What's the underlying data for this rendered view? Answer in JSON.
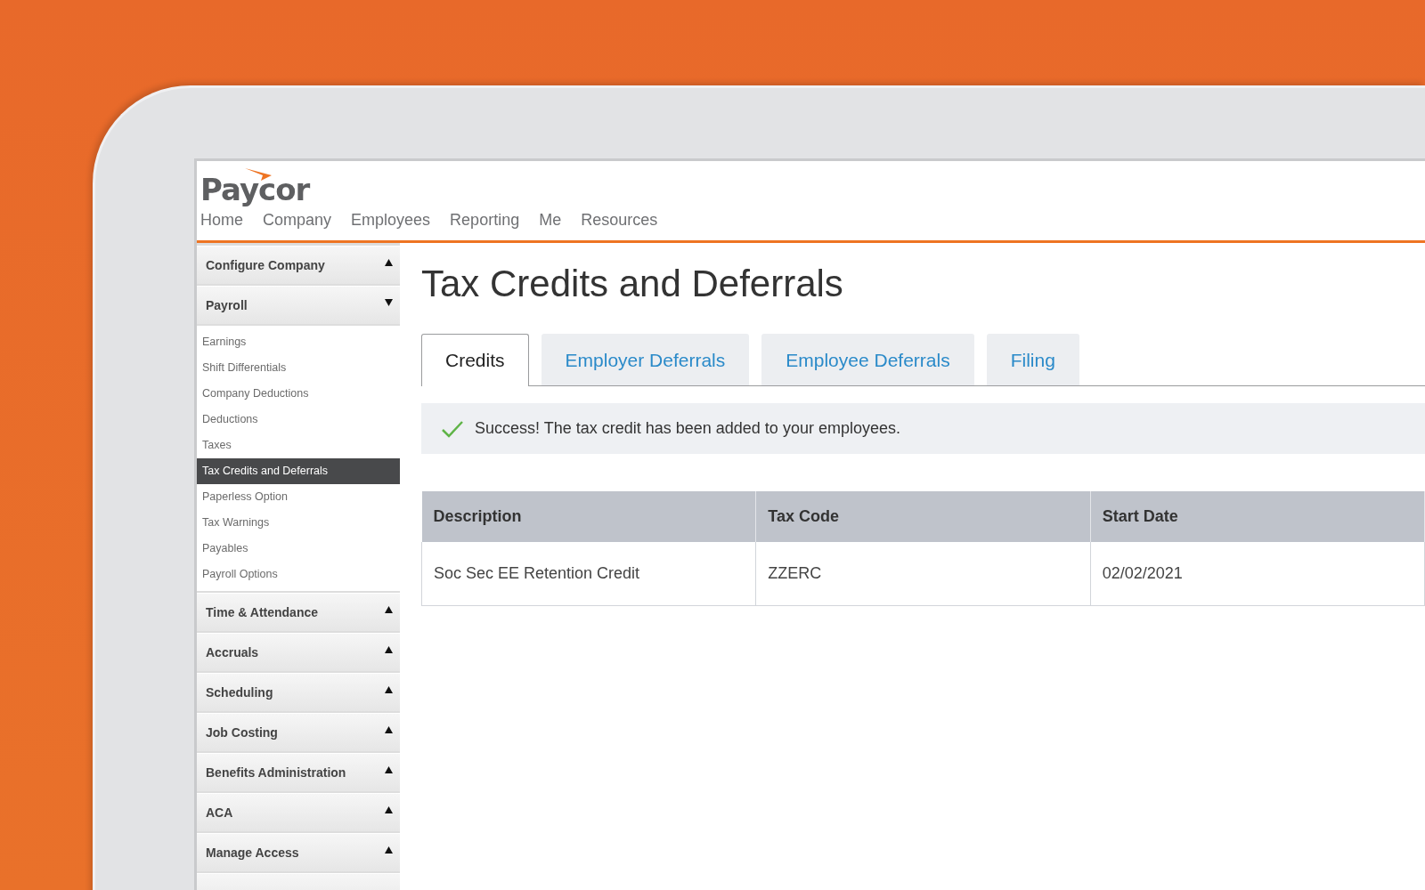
{
  "logo": {
    "text": "Paycor"
  },
  "nav": [
    "Home",
    "Company",
    "Employees",
    "Reporting",
    "Me",
    "Resources"
  ],
  "sidebar": {
    "sections": [
      {
        "label": "Configure Company",
        "expanded": false
      },
      {
        "label": "Payroll",
        "expanded": true,
        "children": [
          {
            "label": "Earnings",
            "selected": false
          },
          {
            "label": "Shift Differentials",
            "selected": false
          },
          {
            "label": "Company Deductions",
            "selected": false
          },
          {
            "label": "Deductions",
            "selected": false
          },
          {
            "label": "Taxes",
            "selected": false
          },
          {
            "label": "Tax Credits and Deferrals",
            "selected": true
          },
          {
            "label": "Paperless Option",
            "selected": false
          },
          {
            "label": "Tax Warnings",
            "selected": false
          },
          {
            "label": "Payables",
            "selected": false
          },
          {
            "label": "Payroll Options",
            "selected": false
          }
        ]
      },
      {
        "label": "Time & Attendance",
        "expanded": false
      },
      {
        "label": "Accruals",
        "expanded": false
      },
      {
        "label": "Scheduling",
        "expanded": false
      },
      {
        "label": "Job Costing",
        "expanded": false
      },
      {
        "label": "Benefits Administration",
        "expanded": false
      },
      {
        "label": "ACA",
        "expanded": false
      },
      {
        "label": "Manage Access",
        "expanded": false
      }
    ]
  },
  "page_title": "Tax Credits and Deferrals",
  "tabs": [
    {
      "label": "Credits",
      "selected": true
    },
    {
      "label": "Employer Deferrals",
      "selected": false
    },
    {
      "label": "Employee Deferrals",
      "selected": false
    },
    {
      "label": "Filing",
      "selected": false
    }
  ],
  "alert": {
    "kind": "success",
    "text": "Success! The tax credit has been added to your employees."
  },
  "table": {
    "columns": [
      "Description",
      "Tax Code",
      "Start Date"
    ],
    "rows": [
      [
        "Soc Sec EE Retention Credit",
        "ZZERC",
        "02/02/2021"
      ]
    ]
  }
}
